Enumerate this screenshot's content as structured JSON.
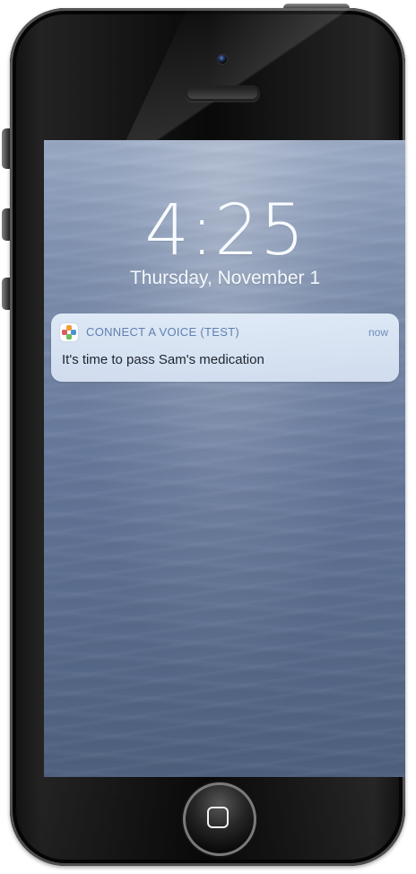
{
  "lock_screen": {
    "time": "4:25",
    "date": "Thursday, November 1"
  },
  "notification": {
    "app_name": "CONNECT A VOICE (TEST)",
    "timestamp": "now",
    "message": "It's time to pass Sam's medication"
  },
  "icons": {
    "app_icon": "connect-a-voice-app-icon",
    "camera": "front-camera-icon",
    "speaker": "speaker-grille-icon",
    "home": "home-square-icon"
  },
  "colors": {
    "notification_app_text": "#5f80b1",
    "notification_time_text": "#6e8dbc",
    "notification_body_text": "#1f2430",
    "clock_text": "#f8fbff"
  }
}
